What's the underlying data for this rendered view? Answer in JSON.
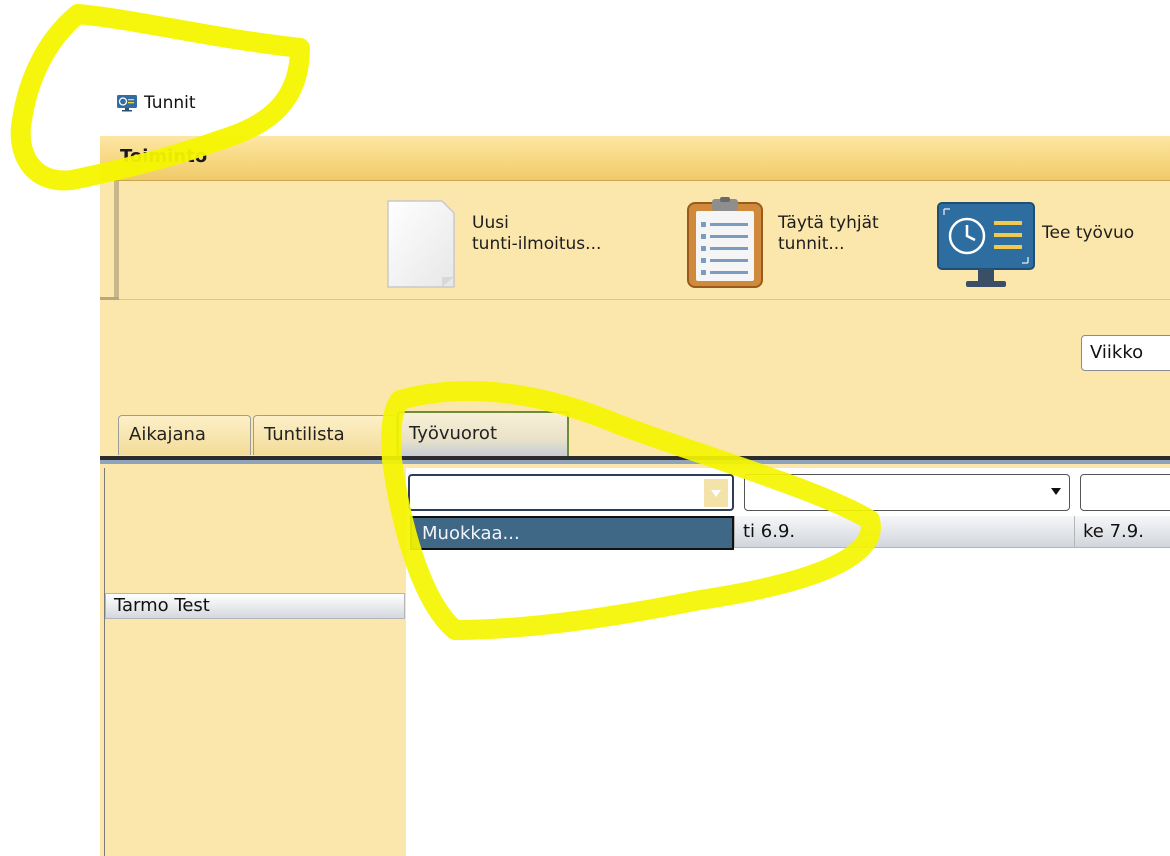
{
  "window": {
    "title": "Tunnit"
  },
  "menubar": {
    "items": [
      "Toiminto"
    ]
  },
  "toolbar": {
    "new_report_label": "Uusi\ntunti-ilmoitus...",
    "fill_hours_label": "Täytä tyhjät\ntunnit...",
    "make_shift_label": "Tee työvuo"
  },
  "week_select": {
    "value": "Viikko"
  },
  "tabs": [
    {
      "label": "Aikajana"
    },
    {
      "label": "Tuntilista"
    },
    {
      "label": "Työvuorot",
      "selected": true
    }
  ],
  "shift_grid": {
    "combo_values": [
      "",
      "",
      ""
    ],
    "dropdown_option": "Muokkaa...",
    "day_headers": [
      "ti 6.9.",
      "ke 7.9."
    ],
    "employees": [
      "Tarmo Test"
    ]
  },
  "colors": {
    "window_bg": "#fbe7ac",
    "highlight": "#f5f500",
    "selection": "#3f6887"
  },
  "icons": [
    "monitor-clock-icon",
    "blank-document-icon",
    "clipboard-checklist-icon"
  ]
}
